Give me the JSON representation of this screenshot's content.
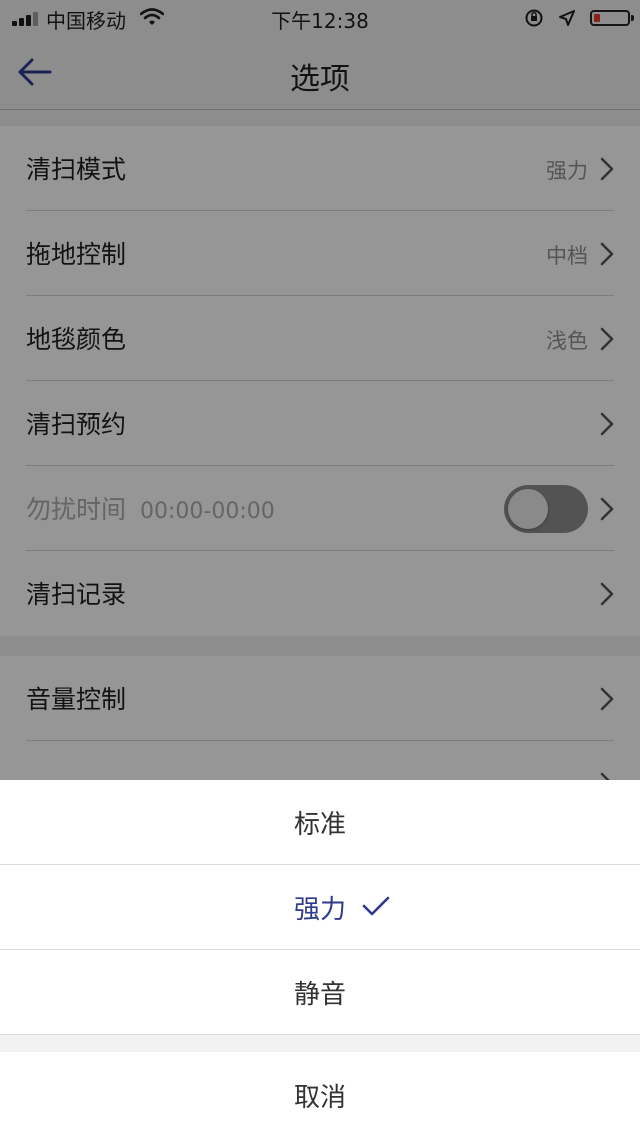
{
  "status_bar": {
    "carrier": "中国移动",
    "time": "下午12:38",
    "battery_level": 0.2
  },
  "nav": {
    "title": "选项",
    "back_icon": "arrow-left-icon"
  },
  "settings": {
    "group1": [
      {
        "label": "清扫模式",
        "value": "强力"
      },
      {
        "label": "拖地控制",
        "value": "中档"
      },
      {
        "label": "地毯颜色",
        "value": "浅色"
      },
      {
        "label": "清扫预约",
        "value": ""
      },
      {
        "label": "勿扰时间",
        "extra": "00:00-00:00",
        "toggle": false
      },
      {
        "label": "清扫记录",
        "value": ""
      }
    ],
    "group2": [
      {
        "label": "音量控制",
        "value": ""
      }
    ]
  },
  "sheet": {
    "options": [
      {
        "label": "标准",
        "selected": false
      },
      {
        "label": "强力",
        "selected": true
      },
      {
        "label": "静音",
        "selected": false
      }
    ],
    "cancel": "取消"
  },
  "colors": {
    "accent": "#2e3a8c",
    "battery_low": "#e53a2b"
  }
}
